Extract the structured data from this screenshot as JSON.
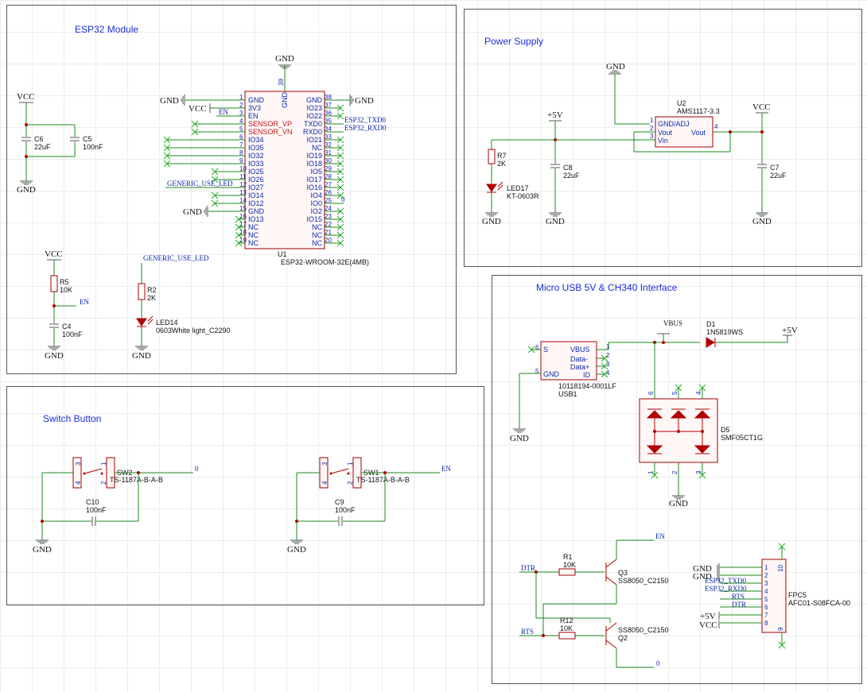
{
  "sections": {
    "esp32": "ESP32 Module",
    "power": "Power Supply",
    "usb": "Micro USB 5V & CH340 Interface",
    "switch": "Switch Button"
  },
  "colors": {
    "wire": "#1d8a1d",
    "body": "#a00000",
    "title": "#1a2fd6",
    "pin": "#0b2aa8"
  },
  "power_symbols": {
    "gnd": "GND",
    "vcc": "VCC",
    "p5v": "+5V",
    "vbus": "VBUS"
  },
  "nets": {
    "en": "EN",
    "zero": "0",
    "generic_led": "GENERIC_USE_LED",
    "esp_txd": "ESP32_TXD0",
    "esp_rxd": "ESP32_RXD0",
    "dtr": "DTR",
    "rts": "RTS"
  },
  "u1": {
    "ref": "U1",
    "value": "ESP32-WROOM-32E(4MB)",
    "top_pin": "GND",
    "top_num": "39",
    "left_pins": [
      {
        "n": "1",
        "name": "GND"
      },
      {
        "n": "2",
        "name": "3V3"
      },
      {
        "n": "3",
        "name": "EN"
      },
      {
        "n": "4",
        "name": "SENSOR_VP"
      },
      {
        "n": "5",
        "name": "SENSOR_VN"
      },
      {
        "n": "6",
        "name": "IO34"
      },
      {
        "n": "7",
        "name": "IO35"
      },
      {
        "n": "8",
        "name": "IO32"
      },
      {
        "n": "9",
        "name": "IO33"
      },
      {
        "n": "10",
        "name": "IO25"
      },
      {
        "n": "11",
        "name": "IO26"
      },
      {
        "n": "12",
        "name": "IO27"
      },
      {
        "n": "13",
        "name": "IO14"
      },
      {
        "n": "14",
        "name": "IO12"
      },
      {
        "n": "15",
        "name": "GND"
      },
      {
        "n": "16",
        "name": "IO13"
      },
      {
        "n": "17",
        "name": "NC"
      },
      {
        "n": "18",
        "name": "NC"
      },
      {
        "n": "19",
        "name": "NC"
      }
    ],
    "right_pins": [
      {
        "n": "38",
        "name": "GND"
      },
      {
        "n": "37",
        "name": "IO23"
      },
      {
        "n": "36",
        "name": "IO22"
      },
      {
        "n": "35",
        "name": "TXD0"
      },
      {
        "n": "34",
        "name": "RXD0"
      },
      {
        "n": "33",
        "name": "IO21"
      },
      {
        "n": "32",
        "name": "NC"
      },
      {
        "n": "31",
        "name": "IO19"
      },
      {
        "n": "30",
        "name": "IO18"
      },
      {
        "n": "29",
        "name": "IO5"
      },
      {
        "n": "28",
        "name": "IO17"
      },
      {
        "n": "27",
        "name": "IO16"
      },
      {
        "n": "26",
        "name": "IO4"
      },
      {
        "n": "25",
        "name": "IO0"
      },
      {
        "n": "24",
        "name": "IO2"
      },
      {
        "n": "23",
        "name": "IO15"
      },
      {
        "n": "22",
        "name": "NC"
      },
      {
        "n": "21",
        "name": "NC"
      },
      {
        "n": "20",
        "name": "NC"
      }
    ]
  },
  "parts": {
    "c6": {
      "ref": "C6",
      "value": "22uF"
    },
    "c5": {
      "ref": "C5",
      "value": "100nF"
    },
    "r5": {
      "ref": "R5",
      "value": "10K"
    },
    "c4": {
      "ref": "C4",
      "value": "100nF"
    },
    "r2": {
      "ref": "R2",
      "value": "2K"
    },
    "led14": {
      "ref": "LED14",
      "value": "0603White light_C2290"
    },
    "u2": {
      "ref": "U2",
      "value": "AMS1117-3.3",
      "p1": "GND/ADJ",
      "p2": "Vout",
      "p3": "Vin",
      "p4": "Vout"
    },
    "r7": {
      "ref": "R7",
      "value": "2K"
    },
    "led17": {
      "ref": "LED17",
      "value": "KT-0603R"
    },
    "c8": {
      "ref": "C8",
      "value": "22uF"
    },
    "c7": {
      "ref": "C7",
      "value": "22uF"
    },
    "usb1": {
      "ref": "USB1",
      "value": "10118194-0001LF",
      "s": "S",
      "gnd": "GND",
      "vbus": "VBUS",
      "dm": "Data-",
      "dp": "Data+",
      "id": "ID"
    },
    "d1": {
      "ref": "D1",
      "value": "1N5819WS"
    },
    "d5": {
      "ref": "D5",
      "value": "SMF05CT1G"
    },
    "r1": {
      "ref": "R1",
      "value": "10K"
    },
    "r12": {
      "ref": "R12",
      "value": "10K"
    },
    "q3": {
      "ref": "Q3",
      "value": "SS8050_C2150"
    },
    "q2": {
      "ref": "Q2",
      "value": "SS8050_C2150"
    },
    "fpc5": {
      "ref": "FPC5",
      "value": "AFC01-S08FCA-00"
    },
    "sw2": {
      "ref": "SW2",
      "value": "TS-1187A-B-A-B"
    },
    "sw1": {
      "ref": "SW1",
      "value": "TS-1187A-B-A-B"
    },
    "c10": {
      "ref": "C10",
      "value": "100nF"
    },
    "c9": {
      "ref": "C9",
      "value": "100nF"
    }
  }
}
